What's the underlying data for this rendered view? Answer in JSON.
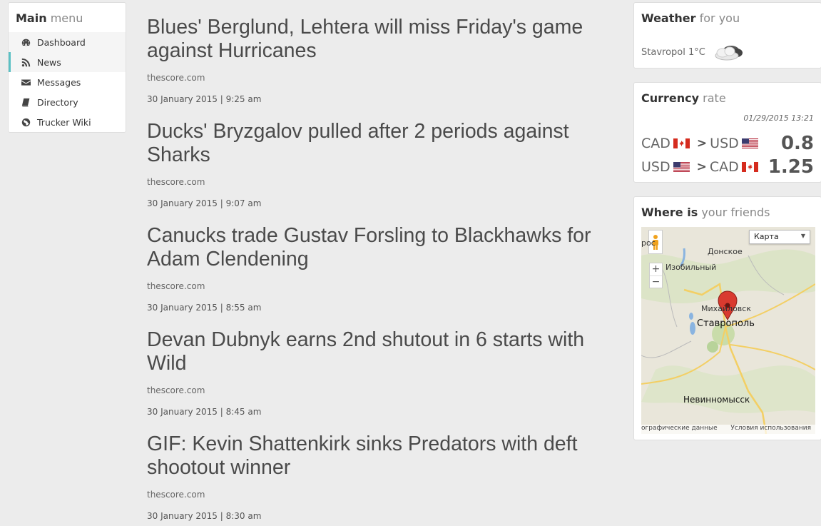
{
  "menu": {
    "title_bold": "Main",
    "title_light": "menu",
    "items": [
      {
        "label": "Dashboard",
        "icon": "dashboard-icon"
      },
      {
        "label": "News",
        "icon": "rss-icon"
      },
      {
        "label": "Messages",
        "icon": "envelope-icon"
      },
      {
        "label": "Directory",
        "icon": "book-icon"
      },
      {
        "label": "Trucker Wiki",
        "icon": "globe-icon"
      }
    ],
    "active_index": 1,
    "accent_color": "#5bc0c4"
  },
  "news": [
    {
      "title": "Blues' Berglund, Lehtera will miss Friday's game against Hurricanes",
      "source": "thescore.com",
      "date": "30 January 2015 | 9:25 am"
    },
    {
      "title": "Ducks' Bryzgalov pulled after 2 periods against Sharks",
      "source": "thescore.com",
      "date": "30 January 2015 | 9:07 am"
    },
    {
      "title": "Canucks trade Gustav Forsling to Blackhawks for Adam Clendening",
      "source": "thescore.com",
      "date": "30 January 2015 | 8:55 am"
    },
    {
      "title": "Devan Dubnyk earns 2nd shutout in 6 starts with Wild",
      "source": "thescore.com",
      "date": "30 January 2015 | 8:45 am"
    },
    {
      "title": "GIF: Kevin Shattenkirk sinks Predators with deft shootout winner",
      "source": "thescore.com",
      "date": "30 January 2015 | 8:30 am"
    }
  ],
  "weather": {
    "title_bold": "Weather",
    "title_light": "for you",
    "location": "Stavropol 1°C",
    "icon": "cloud-icon"
  },
  "currency": {
    "title_bold": "Currency",
    "title_light": "rate",
    "timestamp": "01/29/2015 13:21",
    "rows": [
      {
        "from": "CAD",
        "to": "USD",
        "value": "0.8"
      },
      {
        "from": "USD",
        "to": "CAD",
        "value": "1.25"
      }
    ]
  },
  "where": {
    "title_bold": "Where is",
    "title_light": "your friends",
    "map_type": "Карта",
    "zoom_in": "+",
    "zoom_out": "−",
    "labels": {
      "donskoe": "Донское",
      "izobilny": "Изобильный",
      "mikhailovsk": "Михайловск",
      "stavropol": "Ставрополь",
      "nevinnomyssk": "Невинномысск",
      "edge_left": "рос"
    },
    "footer_left": "ографические данные",
    "footer_right": "Условия использования"
  }
}
